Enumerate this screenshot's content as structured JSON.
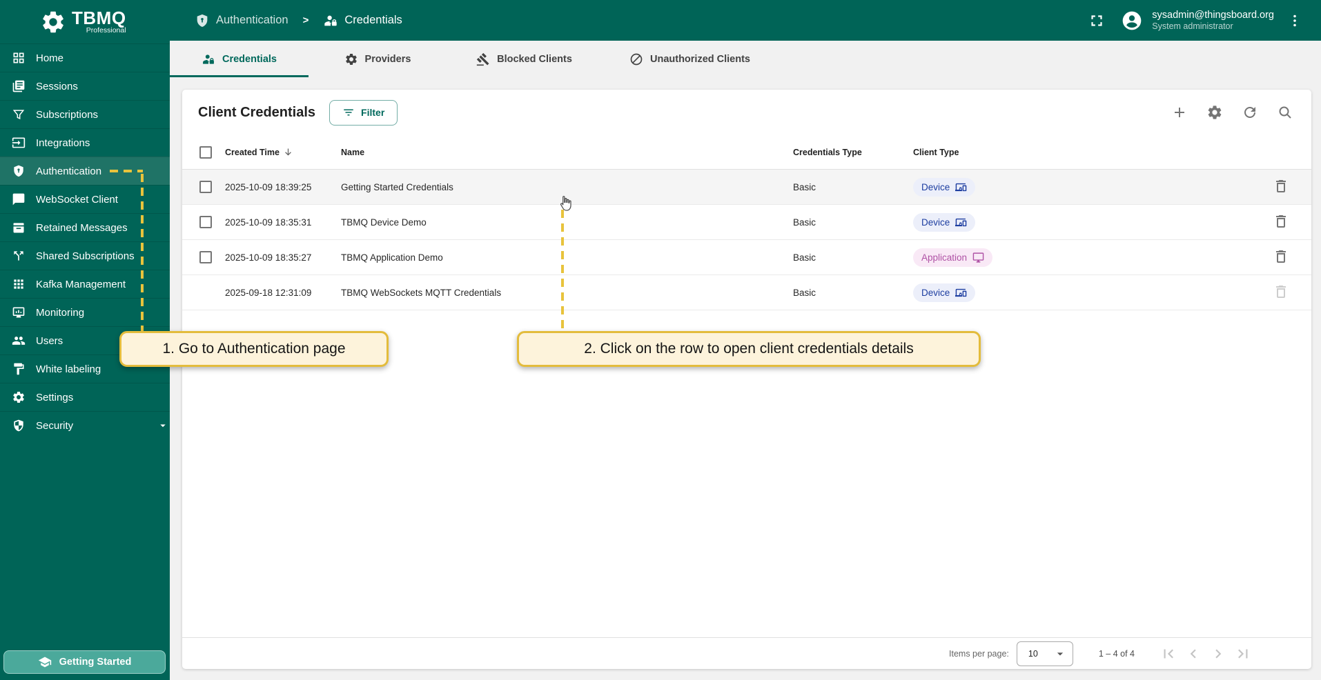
{
  "app": {
    "name": "TBMQ",
    "edition": "Professional"
  },
  "header": {
    "breadcrumb": [
      {
        "label": "Authentication",
        "icon": "shield-lock-icon"
      },
      {
        "label": "Credentials",
        "icon": "person-lock-icon"
      }
    ],
    "separator": ">",
    "user": {
      "email": "sysadmin@thingsboard.org",
      "role": "System administrator"
    }
  },
  "sidebar": {
    "items": [
      {
        "label": "Home",
        "icon": "dashboard-icon",
        "active": false
      },
      {
        "label": "Sessions",
        "icon": "sessions-icon",
        "active": false
      },
      {
        "label": "Subscriptions",
        "icon": "filter-funnel-icon",
        "active": false
      },
      {
        "label": "Integrations",
        "icon": "input-icon",
        "active": false
      },
      {
        "label": "Authentication",
        "icon": "shield-lock-icon",
        "active": true
      },
      {
        "label": "WebSocket Client",
        "icon": "chat-icon",
        "active": false
      },
      {
        "label": "Retained Messages",
        "icon": "archive-icon",
        "active": false
      },
      {
        "label": "Shared Subscriptions",
        "icon": "call-split-icon",
        "active": false
      },
      {
        "label": "Kafka Management",
        "icon": "apps-grid-icon",
        "active": false
      },
      {
        "label": "Monitoring",
        "icon": "monitor-icon",
        "active": false
      },
      {
        "label": "Users",
        "icon": "people-icon",
        "active": false
      },
      {
        "label": "White labeling",
        "icon": "paint-icon",
        "active": false
      },
      {
        "label": "Settings",
        "icon": "gear-icon",
        "active": false
      },
      {
        "label": "Security",
        "icon": "shield-half-icon",
        "active": false,
        "expandable": true
      }
    ],
    "getting_started": "Getting Started"
  },
  "tabs": [
    {
      "label": "Credentials",
      "icon": "person-lock-icon",
      "active": true
    },
    {
      "label": "Providers",
      "icon": "gear-icon",
      "active": false
    },
    {
      "label": "Blocked Clients",
      "icon": "gavel-icon",
      "active": false
    },
    {
      "label": "Unauthorized Clients",
      "icon": "block-icon",
      "active": false
    }
  ],
  "main": {
    "title": "Client Credentials",
    "filter_label": "Filter",
    "table": {
      "columns": [
        "Created Time",
        "Name",
        "Credentials Type",
        "Client Type"
      ],
      "rows": [
        {
          "created": "2025-10-09 18:39:25",
          "name": "Getting Started Credentials",
          "credentials_type": "Basic",
          "client_type": "Device",
          "has_checkbox": true,
          "deletable": true,
          "highlighted": true
        },
        {
          "created": "2025-10-09 18:35:31",
          "name": "TBMQ Device Demo",
          "credentials_type": "Basic",
          "client_type": "Device",
          "has_checkbox": true,
          "deletable": true,
          "highlighted": false
        },
        {
          "created": "2025-10-09 18:35:27",
          "name": "TBMQ Application Demo",
          "credentials_type": "Basic",
          "client_type": "Application",
          "has_checkbox": true,
          "deletable": true,
          "highlighted": false
        },
        {
          "created": "2025-09-18 12:31:09",
          "name": "TBMQ WebSockets MQTT Credentials",
          "credentials_type": "Basic",
          "client_type": "Device",
          "has_checkbox": false,
          "deletable": false,
          "highlighted": false
        }
      ]
    },
    "paginator": {
      "items_per_page_label": "Items per page:",
      "page_size": "10",
      "range": "1 – 4 of 4"
    }
  },
  "annotations": {
    "step1": "1. Go to Authentication page",
    "step2": "2. Click on the row to open client credentials details"
  },
  "colors": {
    "primary_teal": "#006457",
    "active_item_teal": "#1F7366",
    "accent_teal": "#00695C",
    "annotation_yellow": "#E8C33C",
    "callout_bg": "#FDF3DB",
    "chip_device_bg": "#ECEFFA",
    "chip_device_text": "#1C3DA0",
    "chip_application_bg": "#F9E9F6",
    "chip_application_text": "#AF52A5"
  }
}
